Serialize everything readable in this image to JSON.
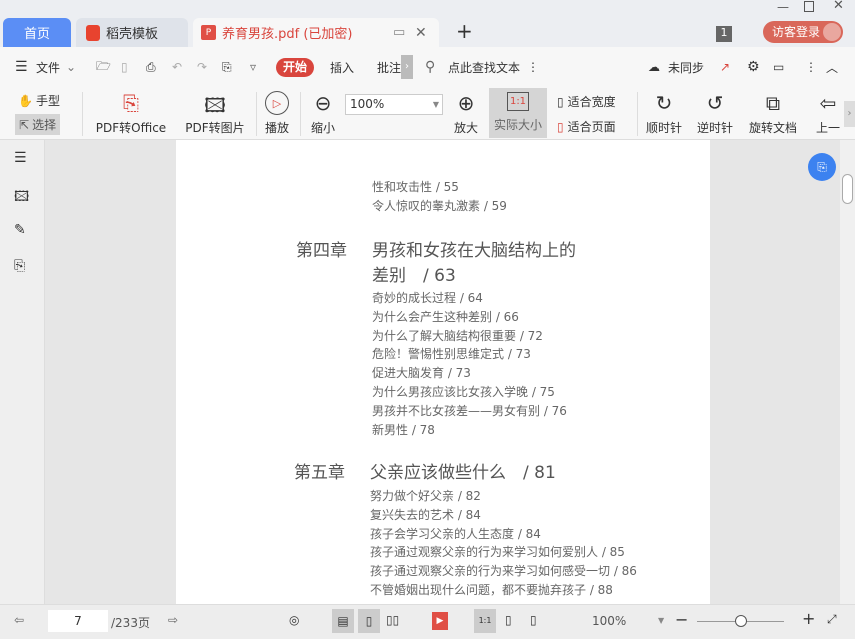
{
  "tabs": {
    "home": "首页",
    "template": "稻壳模板",
    "document": "养育男孩.pdf (已加密)",
    "new_tab": "+"
  },
  "header": {
    "badge_count": "1",
    "login": "访客登录"
  },
  "toolbar1": {
    "file": "文件",
    "start": "开始",
    "insert": "插入",
    "annotate": "批注",
    "search": "点此查找文本",
    "sync": "未同步"
  },
  "toolbar2": {
    "hand": "手型",
    "select": "选择",
    "pdf_office": "PDF转Office",
    "pdf_image": "PDF转图片",
    "play": "播放",
    "zoom_out": "缩小",
    "zoom_value": "100%",
    "zoom_in": "放大",
    "actual": "实际大小",
    "fit_width": "适合宽度",
    "fit_page": "适合页面",
    "clockwise": "顺时针",
    "counter": "逆时针",
    "rotate": "旋转文档",
    "prev": "上一"
  },
  "page": {
    "top": [
      {
        "t": "性和攻击性 / 55"
      },
      {
        "t": "令人惊叹的睾丸激素 / 59"
      }
    ],
    "ch4": {
      "label": "第四章",
      "title1": "男孩和女孩在大脑结构上的",
      "title2": "差别　/ 63",
      "items": [
        "奇妙的成长过程 / 64",
        "为什么会产生这种差别 / 66",
        "为什么了解大脑结构很重要 / 72",
        "危险！警惕性别思维定式 / 73",
        "促进大脑发育 / 73",
        "为什么男孩应该比女孩入学晚 / 75",
        "男孩并不比女孩差——男女有别 / 76",
        "新男性 / 78"
      ]
    },
    "ch5": {
      "label": "第五章",
      "title": "父亲应该做些什么　/ 81",
      "items": [
        "努力做个好父亲 / 82",
        "复兴失去的艺术 / 84",
        "孩子会学习父亲的人生态度 / 84",
        "孩子通过观察父亲的行为来学习如何爱别人 / 85",
        "孩子通过观察父亲的行为来学习如何感受一切 / 86",
        "不管婚姻出现什么问题，都不要抛弃孩子 / 88"
      ]
    }
  },
  "status": {
    "page": "7",
    "total": "/233页",
    "zoom": "100%",
    "zoom_fraction": 0.5
  },
  "colors": {
    "accent": "#5b8ef5",
    "start": "#d9453d",
    "login": "#d9675a"
  }
}
